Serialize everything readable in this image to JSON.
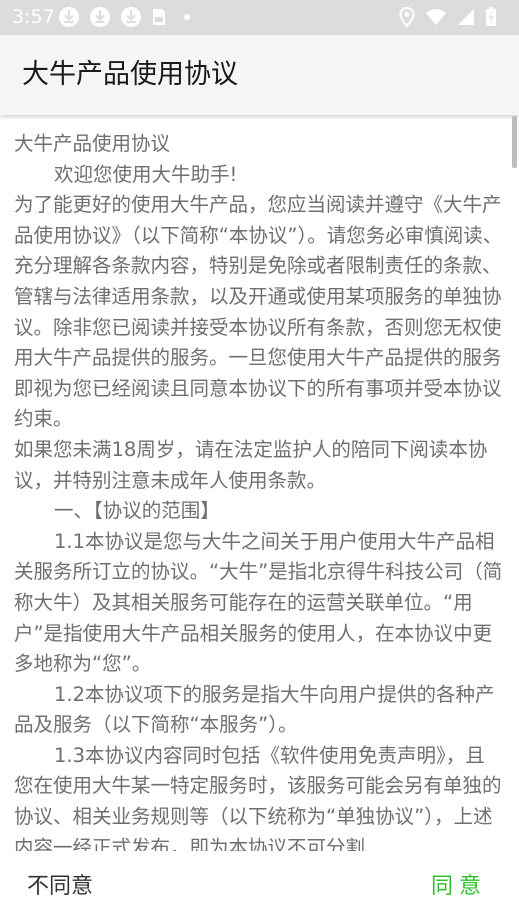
{
  "status_bar": {
    "time": "3:57",
    "left_icons": [
      "download-icon",
      "download-icon",
      "download-icon",
      "sim-card-icon",
      "dot-icon"
    ],
    "right_icons": [
      "location-icon",
      "wifi-icon",
      "signal-icon",
      "battery-icon"
    ]
  },
  "app_bar": {
    "title": "大牛产品使用协议"
  },
  "content": {
    "paragraphs": [
      "大牛产品使用协议",
      "欢迎您使用大牛助手!",
      "为了能更好的使用大牛产品，您应当阅读并遵守《大牛产品使用协议》（以下简称“本协议”）。请您务必审慎阅读、充分理解各条款内容，特别是免除或者限制责任的条款、管辖与法律适用条款，以及开通或使用某项服务的单独协议。除非您已阅读并接受本协议所有条款，否则您无权使用大牛产品提供的服务。一旦您使用大牛产品提供的服务即视为您已经阅读且同意本协议下的所有事项并受本协议约束。",
      "如果您未满18周岁，请在法定监护人的陪同下阅读本协议，并特别注意未成年人使用条款。",
      "一、【协议的范围】",
      "1.1本协议是您与大牛之间关于用户使用大牛产品相关服务所订立的协议。“大牛”是指北京得牛科技公司（简称大牛）及其相关服务可能存在的运营关联单位。“用户”是指使用大牛产品相关服务的使用人，在本协议中更多地称为“您”。",
      "1.2本协议项下的服务是指大牛向用户提供的各种产品及服务（以下简称“本服务”）。",
      "1.3本协议内容同时包括《软件使用免责声明》，且您在使用大牛某一特定服务时，该服务可能会另有单独的协议、相关业务规则等（以下统称为“单独协议”），上述内容一经正式发布，即为本协议不可分割"
    ]
  },
  "bottom_bar": {
    "disagree_label": "不同意",
    "agree_label": "同意"
  },
  "colors": {
    "status_bar_bg": "#dcdcdc",
    "app_bar_bg": "#f5f5f5",
    "body_text": "#6f6f6f",
    "agree": "#2fc22f",
    "disagree": "#333333"
  }
}
